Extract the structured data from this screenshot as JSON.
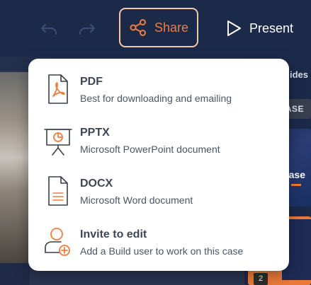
{
  "toolbar": {
    "undo_icon": "undo-icon",
    "redo_icon": "redo-icon",
    "share_label": "Share",
    "share_icon": "share-icon",
    "present_label": "Present",
    "present_icon": "play-icon",
    "accent_color": "#ef7d3c",
    "share_border_color": "#f5c7a8"
  },
  "slides_panel": {
    "header_fragment": "ides",
    "thumbnails": [
      {
        "text": "ASE"
      },
      {
        "text": "ase"
      },
      {
        "badge": "2"
      }
    ]
  },
  "share_menu": {
    "items": [
      {
        "title": "PDF",
        "description": "Best for downloading and emailing",
        "icon": "pdf-file-icon"
      },
      {
        "title": "PPTX",
        "description": "Microsoft PowerPoint document",
        "icon": "presentation-easel-icon"
      },
      {
        "title": "DOCX",
        "description": "Microsoft Word document",
        "icon": "document-file-icon"
      },
      {
        "title": "Invite to edit",
        "description": "Add a Build user to work on this case",
        "icon": "add-user-icon"
      }
    ]
  }
}
